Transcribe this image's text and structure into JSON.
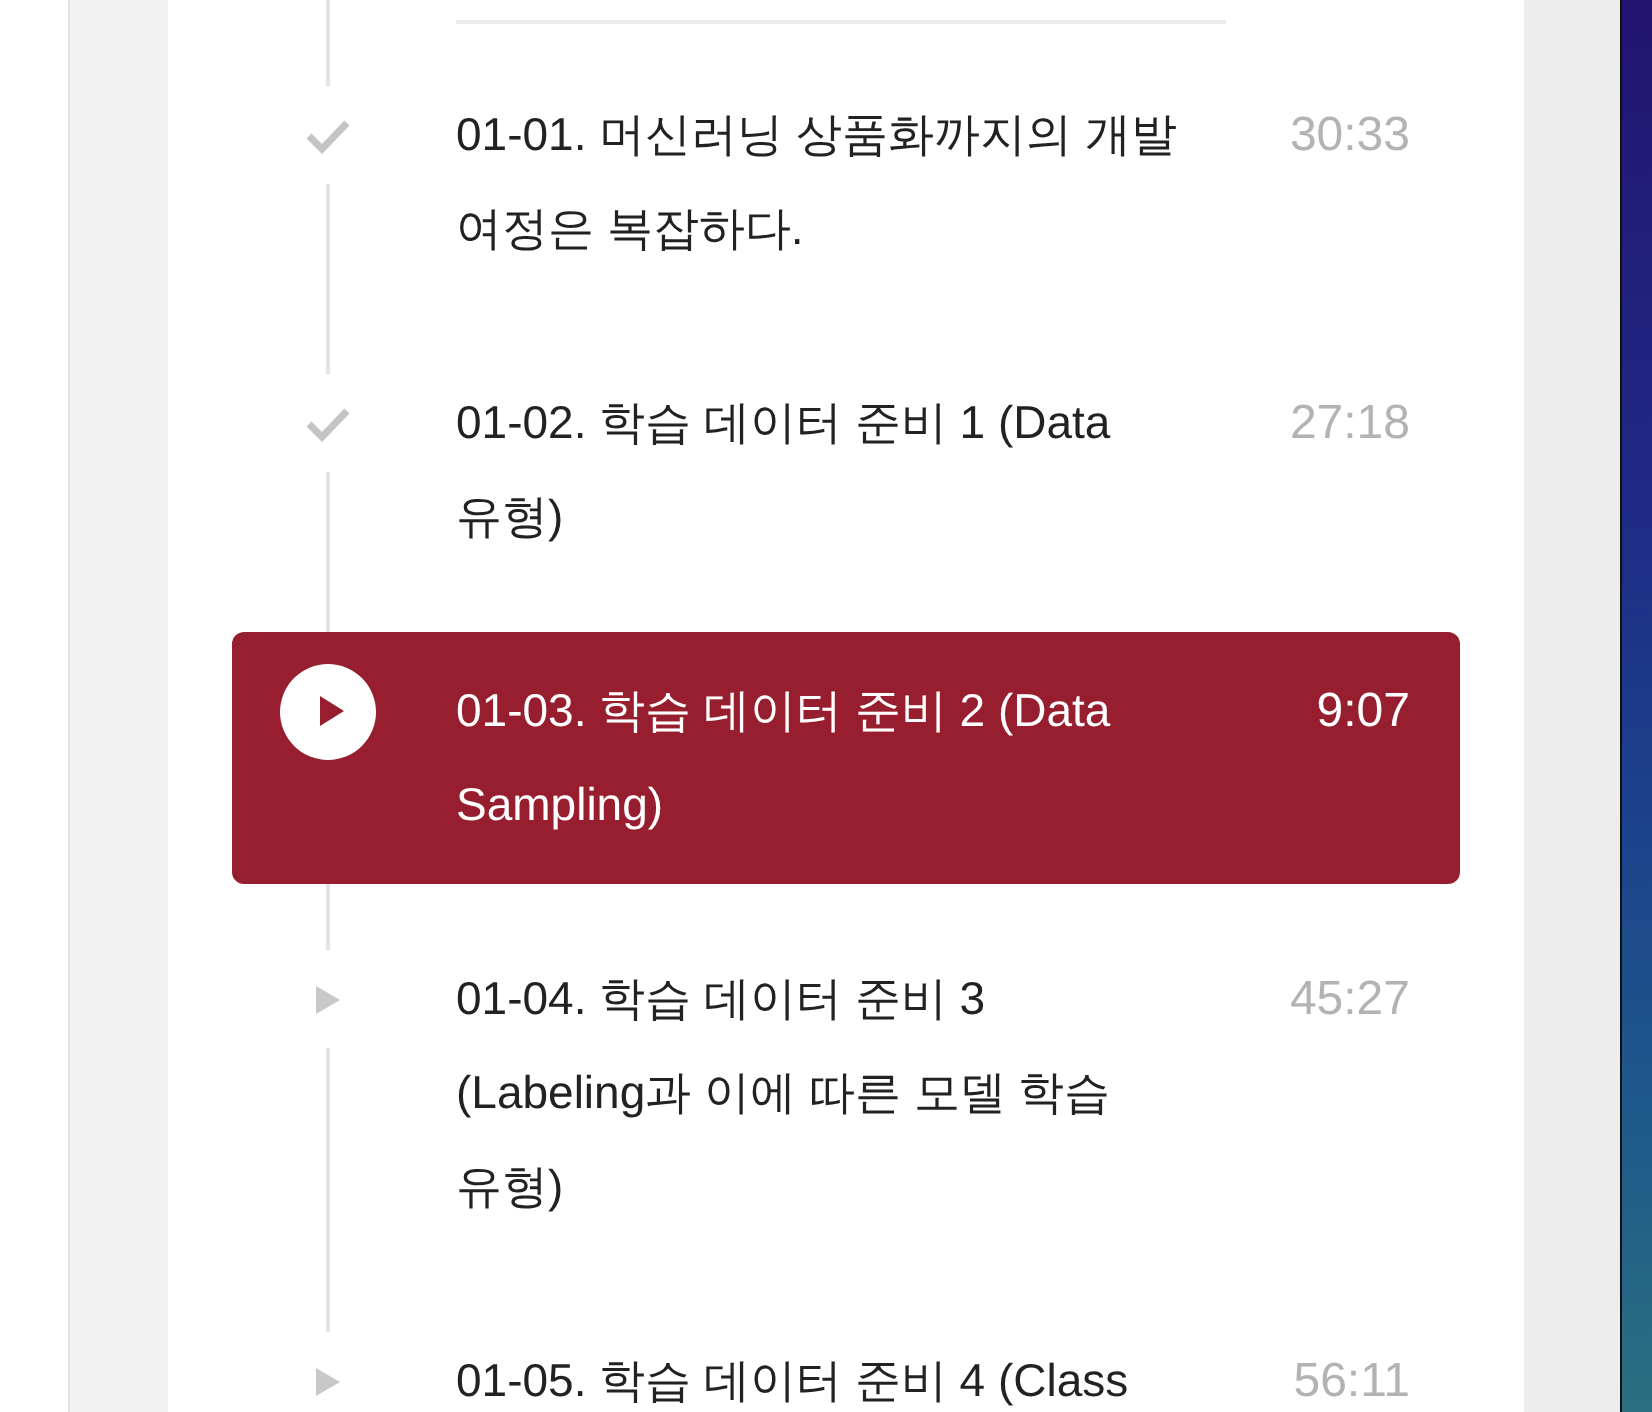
{
  "lectures": [
    {
      "title": "01-01. 머신러닝 상품화까지의 개발 여정은 복잡하다.",
      "duration": "30:33",
      "watched": true,
      "selected": false
    },
    {
      "title": "01-02. 학습 데이터 준비 1 (Data 유형)",
      "duration": "27:18",
      "watched": true,
      "selected": false
    },
    {
      "title": "01-03. 학습 데이터 준비 2 (Data Sampling)",
      "duration": "9:07",
      "watched": false,
      "selected": true
    },
    {
      "title": "01-04. 학습 데이터 준비 3 (Labeling과 이에 따른 모델 학습 유형)",
      "duration": "45:27",
      "watched": false,
      "selected": false
    },
    {
      "title": "01-05. 학습 데이터 준비 4 (Class",
      "duration": "56:11",
      "watched": false,
      "selected": false
    }
  ]
}
